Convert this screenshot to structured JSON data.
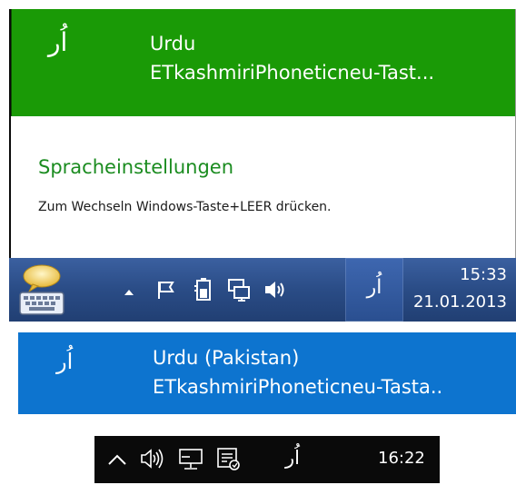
{
  "win8": {
    "flyout": {
      "input_glyph": "اُر",
      "language": "Urdu",
      "keyboard": "ETkashmiriPhoneticneu-Tast...",
      "settings_link": "Spracheinstellungen",
      "hint": "Zum Wechseln Windows-Taste+LEER drücken."
    },
    "taskbar": {
      "lang_indicator": "اُر",
      "time": "15:33",
      "date": "21.01.2013"
    }
  },
  "win10": {
    "flyout": {
      "input_glyph": "اُر",
      "language": "Urdu (Pakistan)",
      "keyboard": "ETkashmiriPhoneticneu-Tasta.."
    },
    "taskbar": {
      "lang_indicator": "اُر",
      "time": "16:22"
    }
  },
  "colors": {
    "win8_flyout_green": "#1a9a06",
    "win8_settings_link": "#1b8c20",
    "win8_taskbar": "#2a4c86",
    "win10_flyout_blue": "#0d74cf",
    "win10_taskbar": "#0a0a0a"
  },
  "icons": [
    "speech-bubble-keyboard-icon",
    "chevron-up-icon",
    "flag-icon",
    "battery-icon",
    "network-icon",
    "speaker-icon",
    "action-center-icon"
  ]
}
